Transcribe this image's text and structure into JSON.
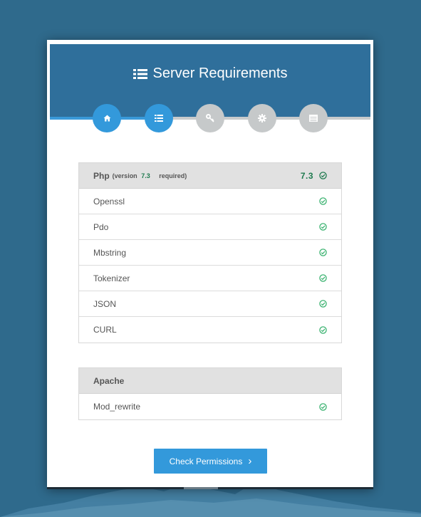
{
  "header": {
    "title": "Server Requirements"
  },
  "steps": [
    {
      "name": "home",
      "icon": "home-icon",
      "state": "active"
    },
    {
      "name": "requirements",
      "icon": "list-icon",
      "state": "active"
    },
    {
      "name": "permissions",
      "icon": "key-icon",
      "state": "inactive"
    },
    {
      "name": "settings",
      "icon": "gear-icon",
      "state": "inactive"
    },
    {
      "name": "finish",
      "icon": "server-icon",
      "state": "inactive"
    }
  ],
  "php": {
    "title": "Php",
    "version_prefix": "(version",
    "required_version": "7.3",
    "version_suffix": "required)",
    "current_version": "7.3",
    "extensions": [
      "Openssl",
      "Pdo",
      "Mbstring",
      "Tokenizer",
      "JSON",
      "CURL"
    ]
  },
  "apache": {
    "title": "Apache",
    "modules": [
      "Mod_rewrite"
    ]
  },
  "button": {
    "label": "Check Permissions",
    "chevron": "›"
  },
  "colors": {
    "accent": "#3399db",
    "ok": "#3cb371",
    "header": "#2f6f9b"
  }
}
